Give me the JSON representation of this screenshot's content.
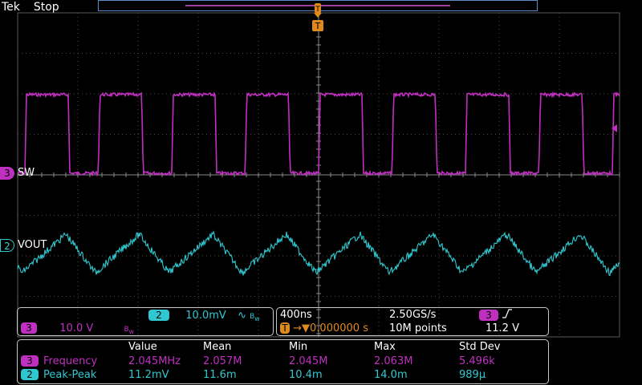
{
  "header": {
    "brand": "Tek",
    "status": "Stop"
  },
  "trigger": {
    "marker": "T",
    "position_label": "T"
  },
  "colors": {
    "ch3": "#c030c0",
    "ch2": "#30c8d0",
    "grid": "#4a4a4a",
    "frame": "#5a5a5a",
    "panel_border": "#c8c8c8"
  },
  "channels": {
    "ch3": {
      "number": "3",
      "label": "SW",
      "scale": "10.0 V",
      "bw_icon": "B",
      "bw_sub": "w"
    },
    "ch2": {
      "number": "2",
      "label": "VOUT",
      "scale": "10.0mV",
      "coupling_icon": "∿",
      "bw_icon": "B",
      "bw_sub": "w"
    }
  },
  "timebase": {
    "scale": "400ns",
    "sample_rate": "2.50GS/s",
    "delay_icon": "T",
    "delay": "→▼0.000000 s",
    "record_length": "10M points"
  },
  "trigger_info": {
    "source": "3",
    "slope_icon": "rising-edge",
    "level": "11.2 V"
  },
  "measurements": {
    "headers": [
      "Value",
      "Mean",
      "Min",
      "Max",
      "Std Dev"
    ],
    "rows": [
      {
        "source": "3",
        "name": "Frequency",
        "values": [
          "2.045MHz",
          "2.057M",
          "2.045M",
          "2.063M",
          "5.496k"
        ]
      },
      {
        "source": "2",
        "name": "Peak-Peak",
        "values": [
          "11.2mV",
          "11.6m",
          "10.4m",
          "14.0m",
          "989μ"
        ]
      }
    ]
  }
}
